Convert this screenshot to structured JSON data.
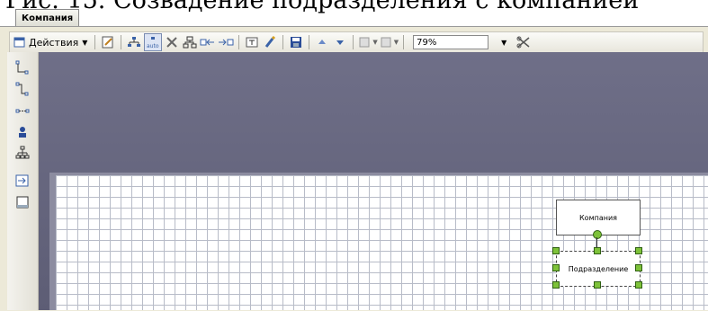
{
  "caption": "Рис. 15. Созвадение подразделения с компанией",
  "document_tab": "Компания",
  "toolbar": {
    "actions_label": "Действия",
    "zoom_value": "79%"
  },
  "diagram": {
    "company_node": "Компания",
    "department_node": "Подразделение"
  },
  "colors": {
    "canvas_bg": "#62627a",
    "handle": "#7ec23a"
  }
}
